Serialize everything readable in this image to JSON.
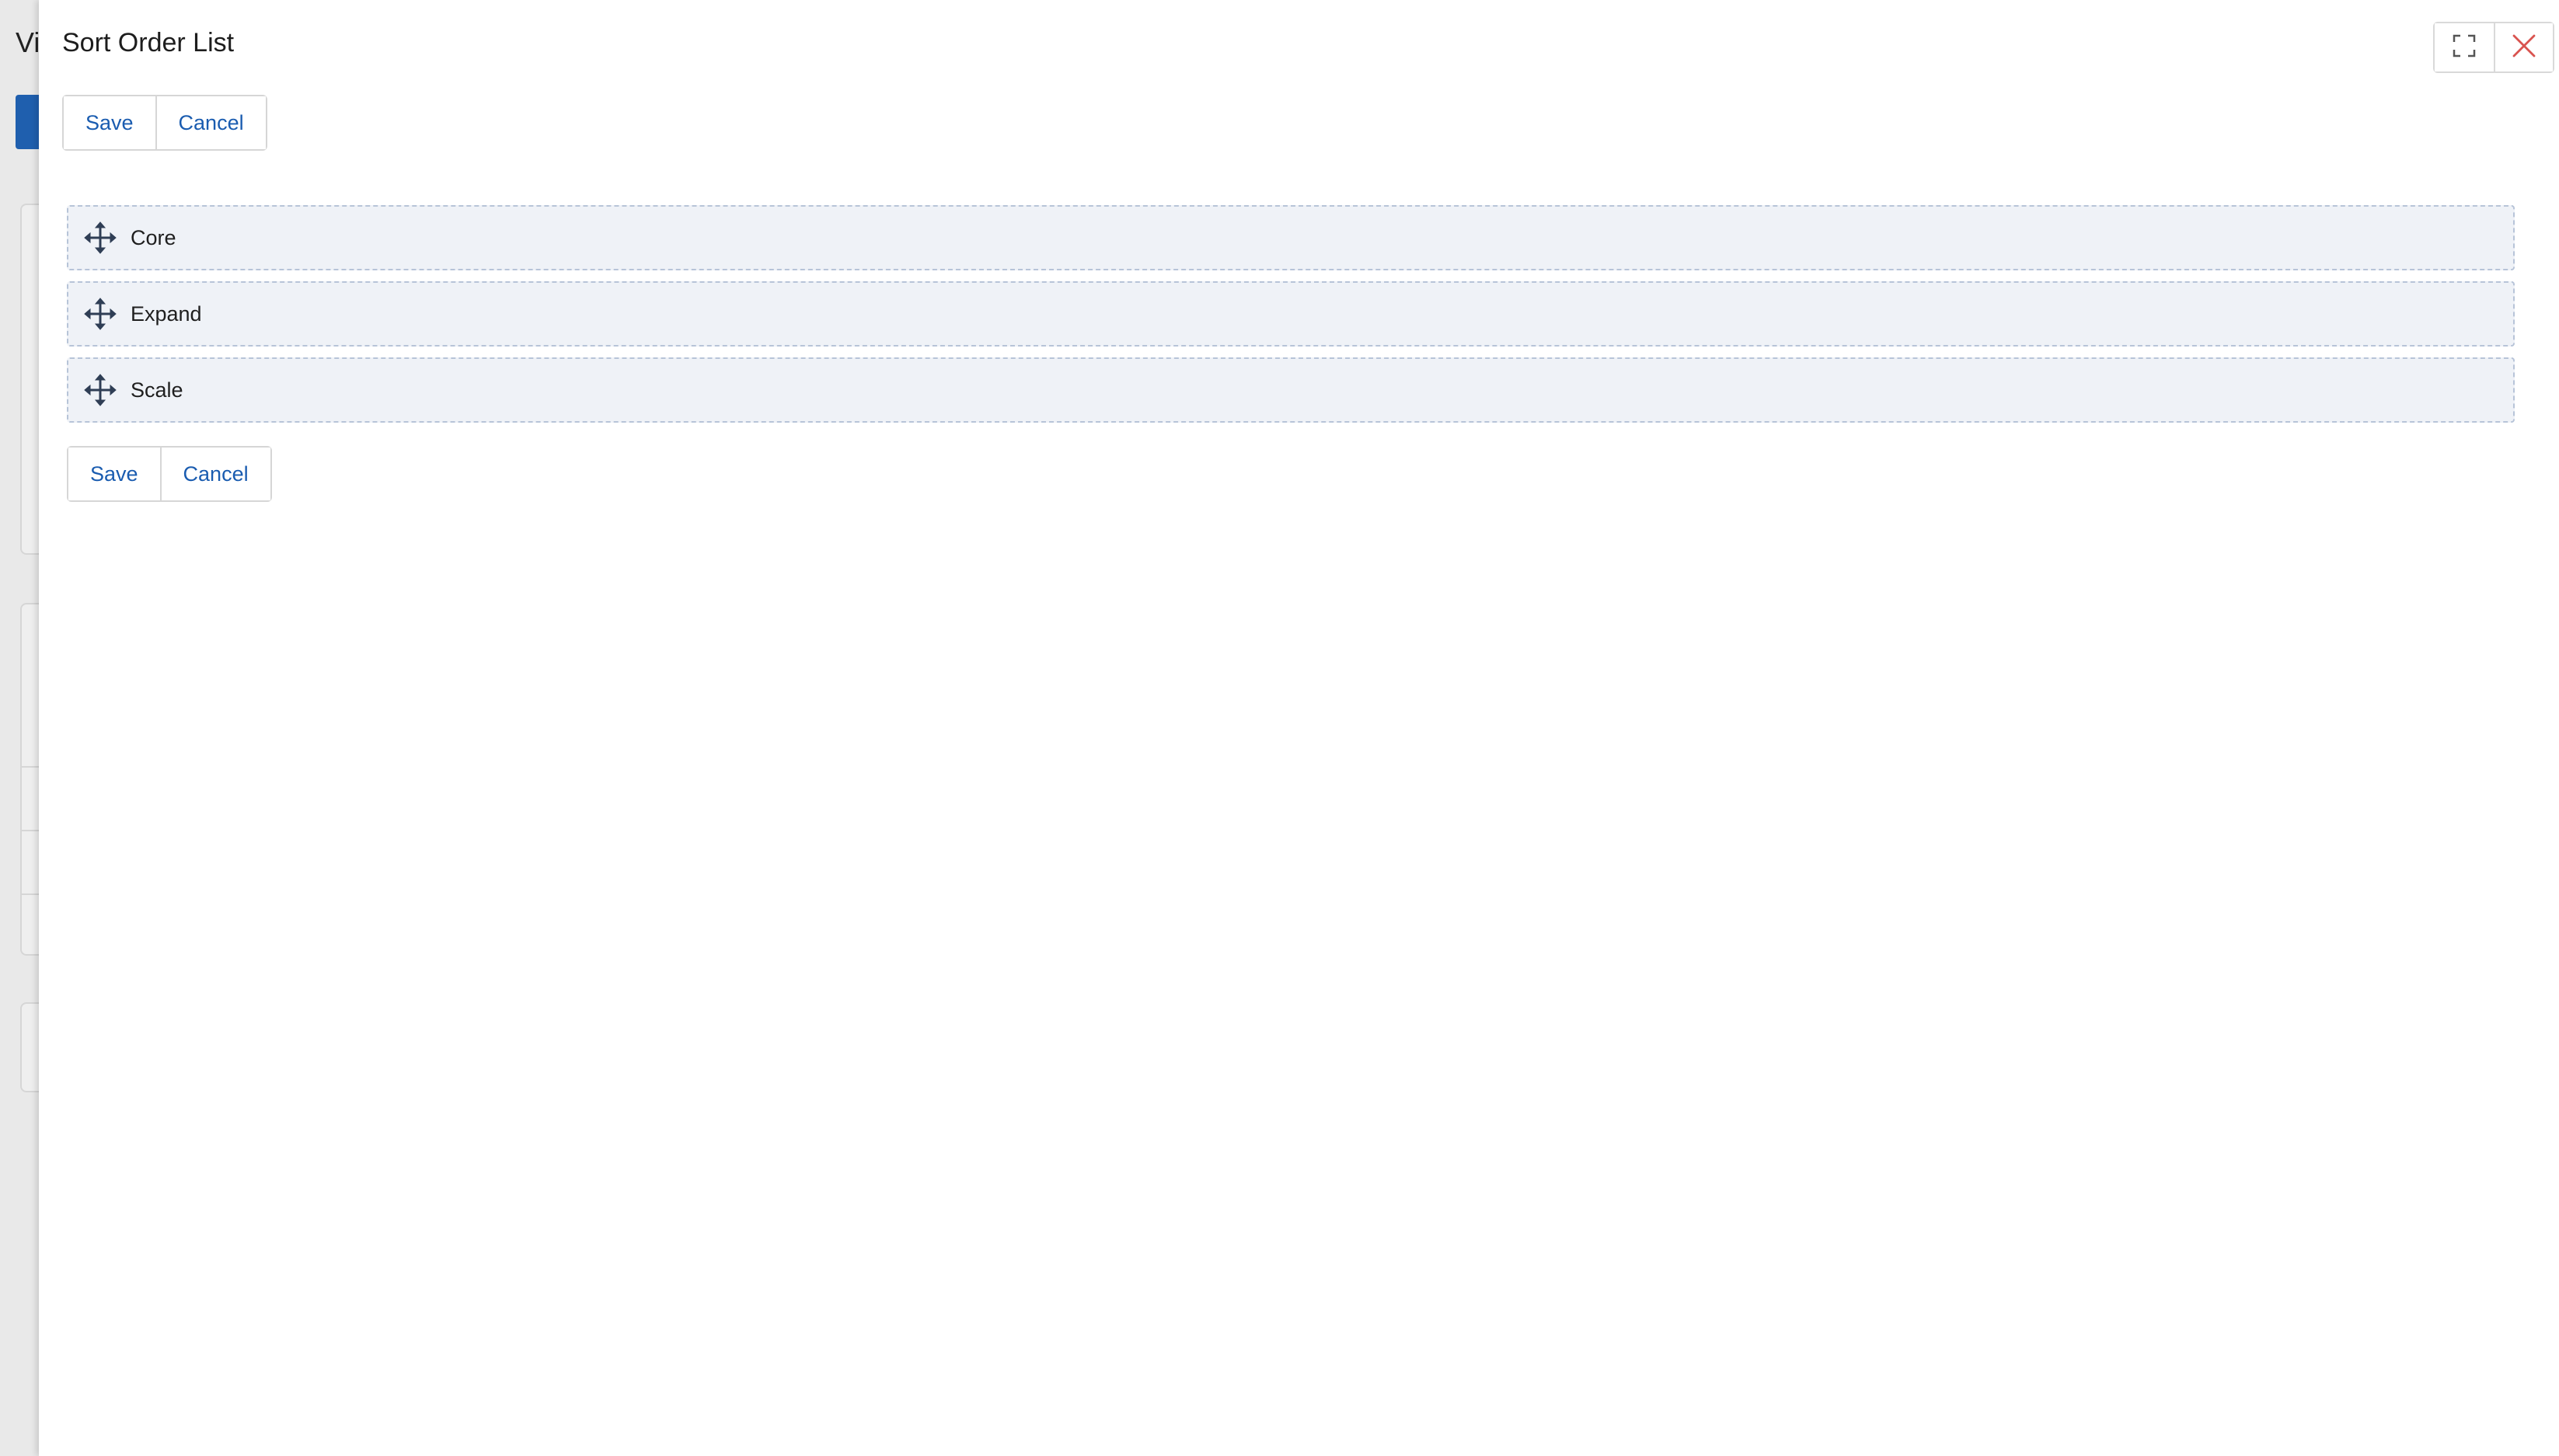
{
  "background_page": {
    "title_fragment": "Vi"
  },
  "drawer": {
    "title": "Sort Order List",
    "controls": {
      "expand_icon": "fullscreen-icon",
      "close_icon": "close-icon",
      "close_color": "#d9534f"
    },
    "top_actions": {
      "save_label": "Save",
      "cancel_label": "Cancel"
    },
    "items": [
      {
        "label": "Core",
        "icon": "drag-move-icon"
      },
      {
        "label": "Expand",
        "icon": "drag-move-icon"
      },
      {
        "label": "Scale",
        "icon": "drag-move-icon"
      }
    ],
    "bottom_actions": {
      "save_label": "Save",
      "cancel_label": "Cancel"
    }
  },
  "colors": {
    "accent": "#1a5cb0",
    "item_bg": "#eff2f7",
    "item_border": "#b7c4d8"
  }
}
